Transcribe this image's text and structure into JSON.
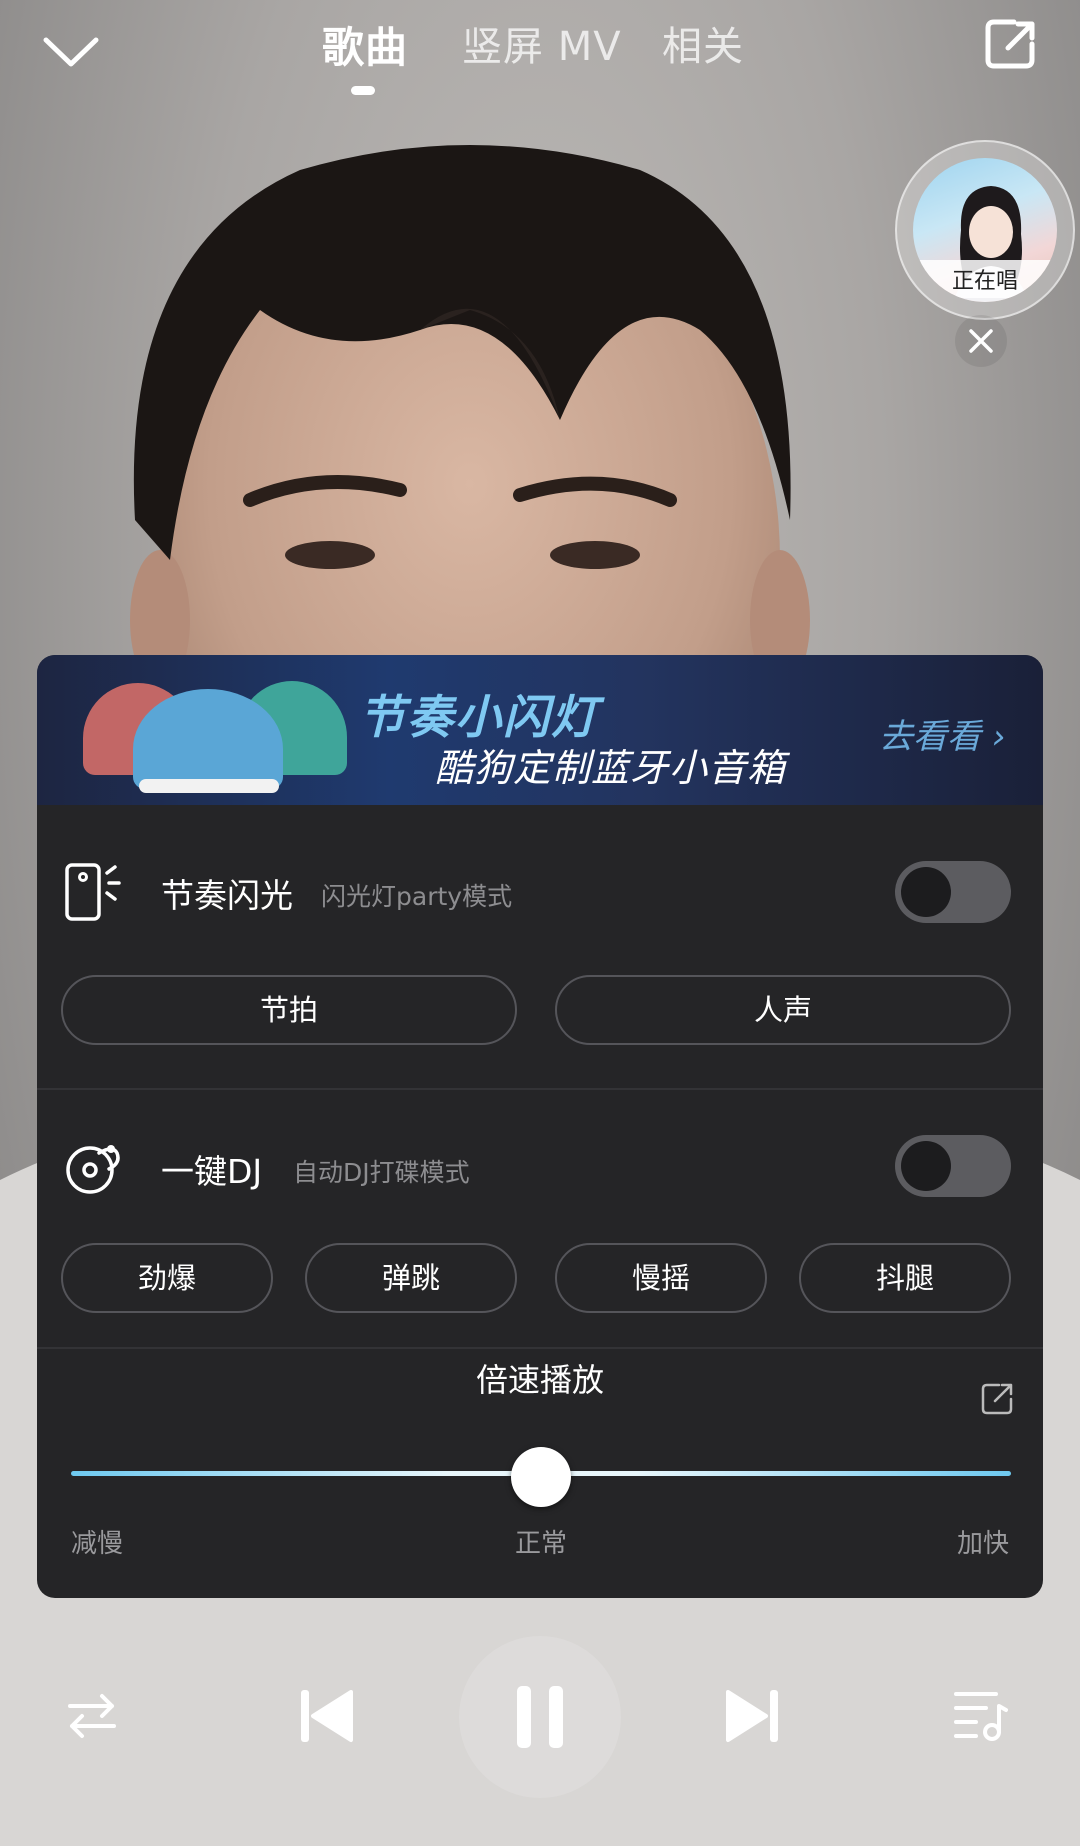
{
  "header": {
    "tabs": [
      {
        "label": "歌曲",
        "active": true
      },
      {
        "label": "竖屏 MV",
        "active": false
      },
      {
        "label": "相关",
        "active": false
      }
    ]
  },
  "singing_widget": {
    "label": "正在唱"
  },
  "panel": {
    "banner": {
      "title": "节奏小闪灯",
      "subtitle": "酷狗定制蓝牙小音箱",
      "cta": "去看看 ›"
    },
    "rhythm_flash": {
      "title": "节奏闪光",
      "subtitle": "闪光灯party模式",
      "enabled": false,
      "options": [
        "节拍",
        "人声"
      ]
    },
    "one_key_dj": {
      "title": "一键DJ",
      "subtitle": "自动DJ打碟模式",
      "enabled": false,
      "options": [
        "劲爆",
        "弹跳",
        "慢摇",
        "抖腿"
      ]
    },
    "speed": {
      "title": "倍速播放",
      "slow_label": "减慢",
      "normal_label": "正常",
      "fast_label": "加快",
      "value_fraction": 0.5
    }
  },
  "controls": {
    "accent": "#6ec9ef"
  }
}
